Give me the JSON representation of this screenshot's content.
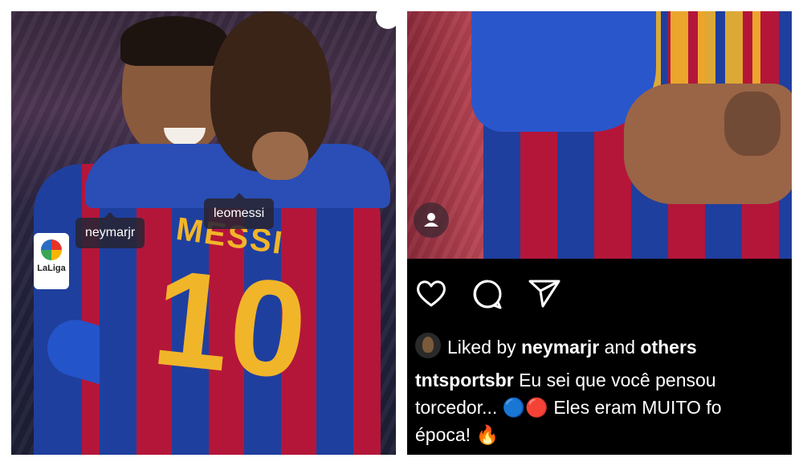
{
  "left_photo": {
    "tags": [
      "neymarjr",
      "leomessi"
    ],
    "jersey_name": "MESSI",
    "jersey_number": "10",
    "badge_label": "LaLiga"
  },
  "right_post": {
    "actions": {
      "like_icon": "heart-icon",
      "comment_icon": "comment-icon",
      "share_icon": "send-icon"
    },
    "likes": {
      "prefix": "Liked by",
      "user": "neymarjr",
      "and": "and",
      "others": "others"
    },
    "caption": {
      "username": "tntsportsbr",
      "line1": "Eu sei que você pensou",
      "line2_start": "torcedor...",
      "line2_end": "Eles eram MUITO fo",
      "line3": "época!"
    },
    "emojis": {
      "blue": "🔵",
      "red": "🔴",
      "fire": "🔥"
    }
  },
  "colors": {
    "barca_blue": "#1f3f9e",
    "barca_red": "#b4163a",
    "gold": "#f1b52a"
  }
}
